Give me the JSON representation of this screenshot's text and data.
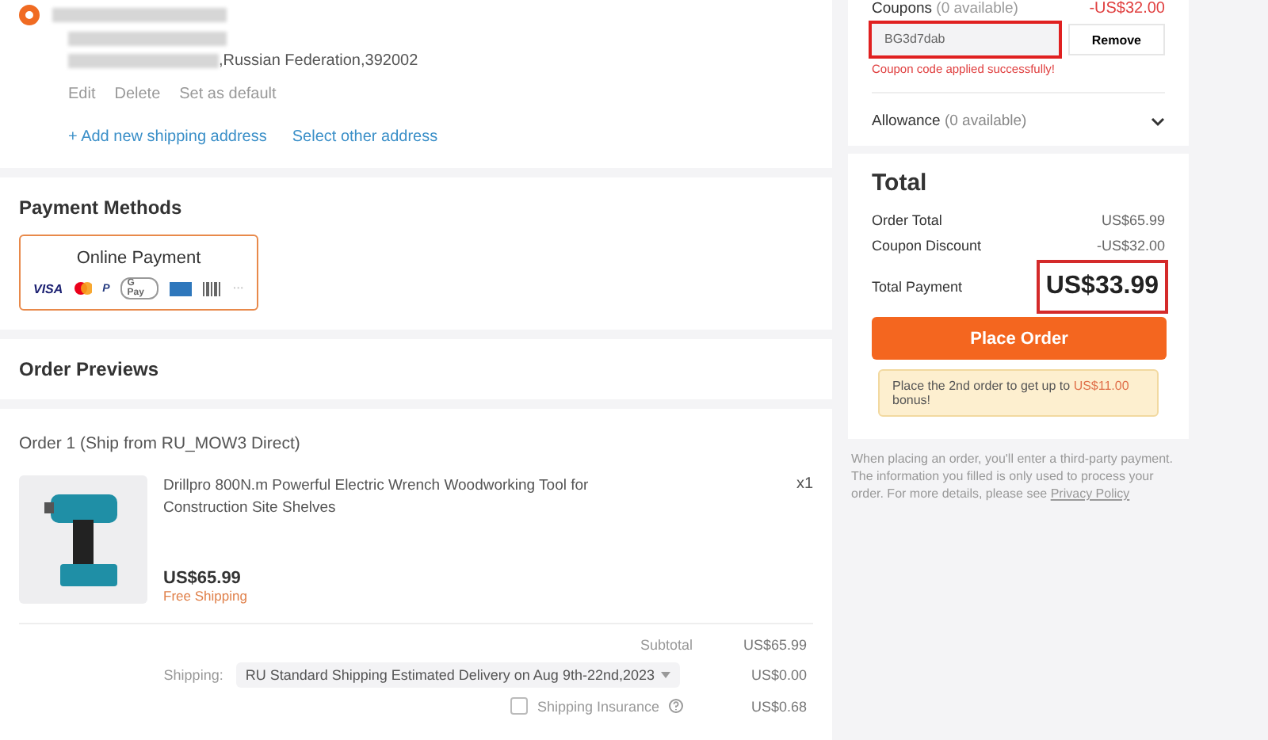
{
  "address": {
    "selected": true,
    "line": ",Russian Federation,392002",
    "actions": [
      "Edit",
      "Delete",
      "Set as default"
    ],
    "links": [
      "+ Add new shipping address",
      "Select other address"
    ]
  },
  "payment": {
    "title": "Payment Methods",
    "method": {
      "label": "Online Payment",
      "selected": true
    },
    "logos": [
      {
        "kind": "visa",
        "text": "VISA"
      },
      {
        "kind": "mastercard"
      },
      {
        "kind": "paypal",
        "text": "P"
      },
      {
        "kind": "gpay",
        "text": "G Pay"
      },
      {
        "kind": "amex"
      },
      {
        "kind": "barcode"
      },
      {
        "kind": "more",
        "text": "···"
      }
    ]
  },
  "order_previews": {
    "title": "Order Previews",
    "order": {
      "title": "Order 1 (Ship from RU_MOW3 Direct)",
      "product": {
        "name": "Drillpro 800N.m Powerful Electric Wrench Woodworking Tool for Construction Site Shelves",
        "quantity": "x1",
        "price": "US$65.99",
        "shipping_note": "Free Shipping"
      },
      "subtotal": {
        "label": "Subtotal",
        "value": "US$65.99"
      },
      "shipping": {
        "label": "Shipping:",
        "option": "RU Standard Shipping Estimated Delivery on Aug 9th-22nd,2023",
        "value": "US$0.00"
      },
      "insurance": {
        "label": "Shipping Insurance",
        "checked": false,
        "value": "US$0.68"
      }
    }
  },
  "coupons": {
    "title": "Coupons",
    "count": "(0 available)",
    "discount": "-US$32.00",
    "code": "BG3d7dab",
    "remove": "Remove",
    "message": "Coupon code applied successfully!",
    "highlighted": true
  },
  "allowance": {
    "title": "Allowance",
    "count": "(0 available)",
    "expanded": false
  },
  "total": {
    "title": "Total",
    "rows": [
      {
        "label": "Order Total",
        "value": "US$65.99"
      },
      {
        "label": "Coupon Discount",
        "value": "-US$32.00"
      }
    ],
    "payment_label": "Total Payment",
    "payment_value": "US$33.99",
    "highlighted": true,
    "button": "Place Order",
    "bonus": {
      "text": "Place the 2nd order to get up to ",
      "amount": "US$11.00",
      "tail": "bonus!"
    }
  },
  "note": {
    "text": "When placing an order, you'll enter a third-party payment. The information you filled is only used to process your order. For more details, please see ",
    "link": "Privacy Policy"
  }
}
